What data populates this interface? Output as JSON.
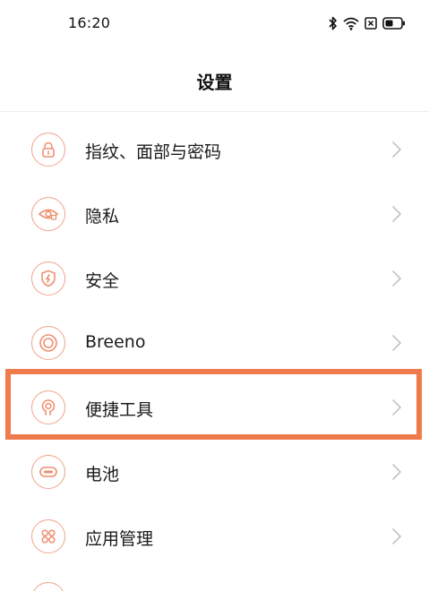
{
  "status_bar": {
    "time": "16:20",
    "icons": [
      "bluetooth-icon",
      "wifi-icon",
      "sim-icon",
      "battery-icon"
    ]
  },
  "header": {
    "title": "设置"
  },
  "settings": {
    "items": [
      {
        "label": "指纹、面部与密码",
        "icon": "lock-icon"
      },
      {
        "label": "隐私",
        "icon": "eye-icon"
      },
      {
        "label": "安全",
        "icon": "shield-icon"
      },
      {
        "label": "Breeno",
        "icon": "breeno-icon"
      },
      {
        "label": "便捷工具",
        "icon": "tools-icon"
      },
      {
        "label": "电池",
        "icon": "battery-icon"
      },
      {
        "label": "应用管理",
        "icon": "apps-icon"
      }
    ]
  },
  "colors": {
    "accent": "#f0a48c",
    "highlight": "#ef7b4d",
    "chevron": "#c4c4c4"
  }
}
